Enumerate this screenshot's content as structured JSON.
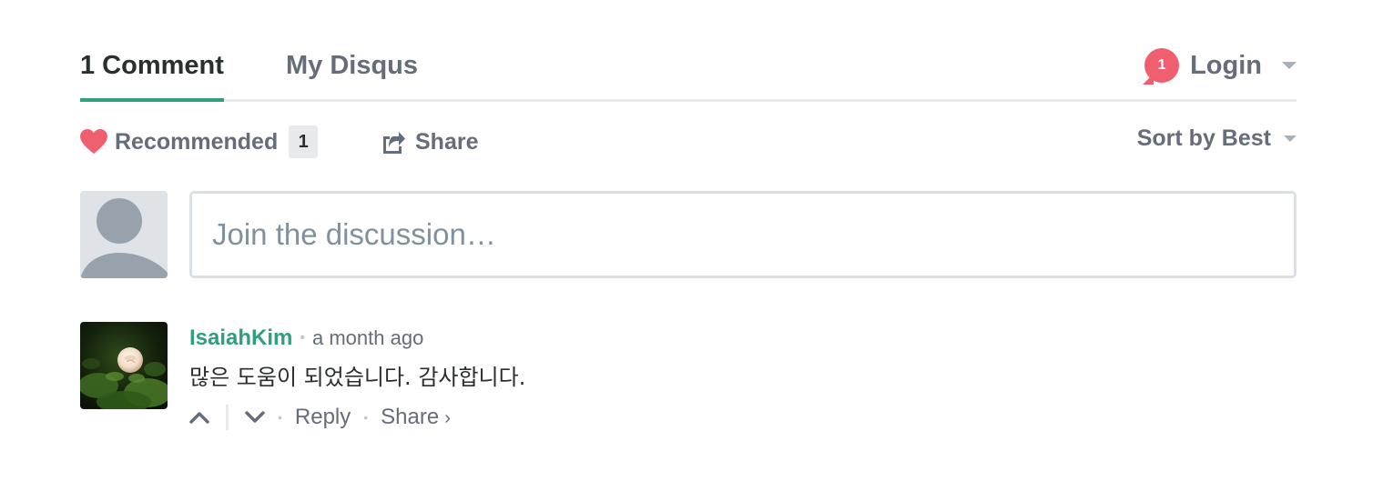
{
  "nav": {
    "comments_tab": "1 Comment",
    "disqus_tab": "My Disqus",
    "notification_count": "1",
    "login_label": "Login"
  },
  "actions": {
    "recommend_label": "Recommended",
    "recommend_count": "1",
    "share_label": "Share",
    "sort_label": "Sort by Best"
  },
  "composer": {
    "placeholder": "Join the discussion…"
  },
  "comment": {
    "author": "IsaiahKim",
    "separator": "•",
    "timestamp": "a month ago",
    "text": "많은 도움이 되었습니다. 감사합니다.",
    "reply_label": "Reply",
    "share_label": "Share",
    "share_chevron": "›"
  },
  "colors": {
    "accent_green": "#2e9f7f",
    "badge_red": "#f05f70",
    "heart_red": "#f05f70",
    "muted_text": "#656c7a",
    "primary_text": "#2a2e2e",
    "rule": "#e7e9ee"
  },
  "icons": {
    "heart": "heart-icon",
    "share": "share-icon",
    "caret": "caret-down-icon",
    "upvote": "chevron-up-icon",
    "downvote": "chevron-down-icon",
    "default_avatar": "user-silhouette-icon"
  }
}
